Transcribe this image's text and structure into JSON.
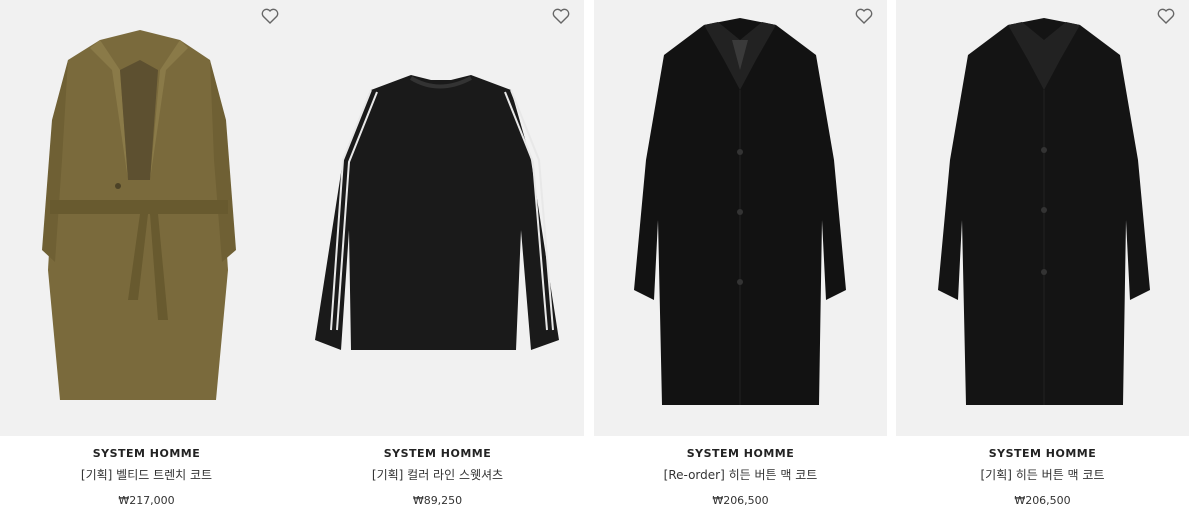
{
  "products": [
    {
      "brand": "SYSTEM HOMME",
      "name": "[기획] 벨티드 트렌치 코트",
      "price": "₩217,000",
      "image": "olive-belted-trench-coat",
      "color": "#7a6a3c"
    },
    {
      "brand": "SYSTEM HOMME",
      "name": "[기획] 컬러 라인 스웻셔츠",
      "price": "₩89,250",
      "image": "black-sweatshirt-white-stripe",
      "color": "#1a1a1a"
    },
    {
      "brand": "SYSTEM HOMME",
      "name": "[Re-order] 히든 버튼 맥 코트",
      "price": "₩206,500",
      "image": "black-mac-coat",
      "color": "#121212"
    },
    {
      "brand": "SYSTEM HOMME",
      "name": "[기획] 히든 버튼 맥 코트",
      "price": "₩206,500",
      "image": "black-mac-coat",
      "color": "#141414"
    }
  ],
  "icons": {
    "wishlist": "heart-outline-icon"
  }
}
